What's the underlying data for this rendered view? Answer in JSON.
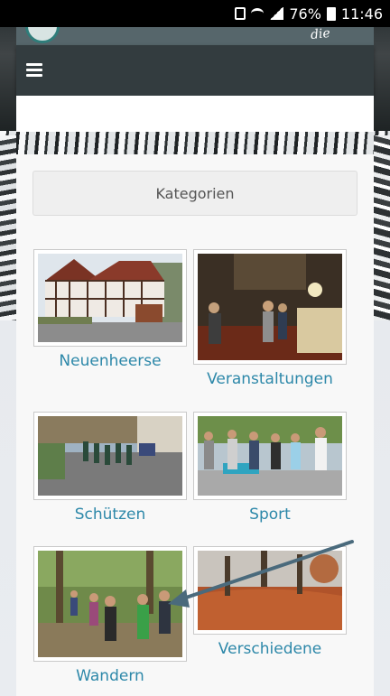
{
  "status_bar": {
    "battery": "76%",
    "time": "11:46"
  },
  "header": {
    "slogan": "die"
  },
  "categories_header": "Kategorien",
  "categories": [
    {
      "label": "Neuenheerse",
      "image": "half-timbered-house"
    },
    {
      "label": "Veranstaltungen",
      "image": "indoor-event"
    },
    {
      "label": "Schützen",
      "image": "parade-street"
    },
    {
      "label": "Sport",
      "image": "people-group-outdoors"
    },
    {
      "label": "Wandern",
      "image": "hikers-forest-path"
    },
    {
      "label": "Verschiedene",
      "image": "autumn-trees-fog"
    }
  ],
  "colors": {
    "link": "#2d88a9",
    "navbar": "#333c3f",
    "arrow": "#4a6a7c"
  }
}
